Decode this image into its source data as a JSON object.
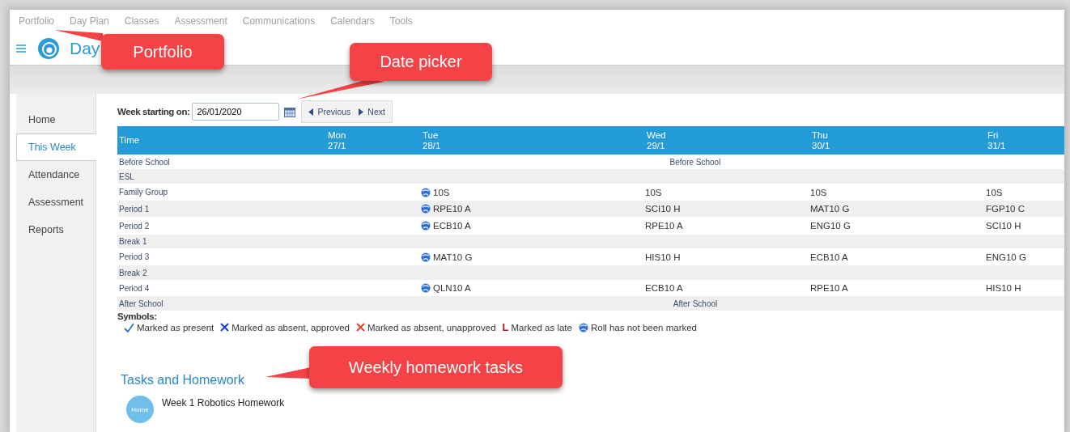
{
  "top_nav": [
    {
      "label": "Portfolio"
    },
    {
      "label": "Day Plan"
    },
    {
      "label": "Classes"
    },
    {
      "label": "Assessment"
    },
    {
      "label": "Communications"
    },
    {
      "label": "Calendars"
    },
    {
      "label": "Tools"
    }
  ],
  "logo": {
    "text": "Day"
  },
  "sidebar": {
    "items": [
      {
        "label": "Home",
        "selected": false
      },
      {
        "label": "This Week",
        "selected": true
      },
      {
        "label": "Attendance",
        "selected": false
      },
      {
        "label": "Assessment",
        "selected": false
      },
      {
        "label": "Reports",
        "selected": false
      }
    ]
  },
  "week_picker": {
    "label": "Week starting on:",
    "value": "26/01/2020",
    "previous": "Previous",
    "next": "Next"
  },
  "timetable": {
    "columns": [
      {
        "day": "Time"
      },
      {
        "day": "Mon",
        "date": "27/1"
      },
      {
        "day": "Tue",
        "date": "28/1"
      },
      {
        "day": "Wed",
        "date": "29/1"
      },
      {
        "day": "Thu",
        "date": "30/1"
      },
      {
        "day": "Fri",
        "date": "31/1"
      }
    ],
    "rows": [
      {
        "kind": "span",
        "label": "Before School",
        "span_text": "Before School"
      },
      {
        "kind": "break",
        "label": "ESL"
      },
      {
        "kind": "lesson",
        "label": "Family Group",
        "cells": [
          {
            "text": ""
          },
          {
            "text": "10S",
            "unmarked": true
          },
          {
            "text": "10S"
          },
          {
            "text": "10S"
          },
          {
            "text": "10S"
          }
        ]
      },
      {
        "kind": "lesson",
        "label": "Period 1",
        "cells": [
          {
            "text": ""
          },
          {
            "text": "RPE10 A",
            "unmarked": true
          },
          {
            "text": "SCI10 H"
          },
          {
            "text": "MAT10 G"
          },
          {
            "text": "FGP10 C"
          }
        ]
      },
      {
        "kind": "lesson",
        "label": "Period 2",
        "cells": [
          {
            "text": ""
          },
          {
            "text": "ECB10 A",
            "unmarked": true
          },
          {
            "text": "RPE10 A"
          },
          {
            "text": "ENG10 G"
          },
          {
            "text": "SCI10 H"
          }
        ]
      },
      {
        "kind": "break",
        "label": "Break 1"
      },
      {
        "kind": "lesson",
        "label": "Period 3",
        "cells": [
          {
            "text": ""
          },
          {
            "text": "MAT10 G",
            "unmarked": true
          },
          {
            "text": "HIS10 H"
          },
          {
            "text": "ECB10 A"
          },
          {
            "text": "ENG10 G"
          }
        ]
      },
      {
        "kind": "break",
        "label": "Break 2"
      },
      {
        "kind": "lesson",
        "label": "Period 4",
        "cells": [
          {
            "text": ""
          },
          {
            "text": "QLN10 A",
            "unmarked": true
          },
          {
            "text": "ECB10 A"
          },
          {
            "text": "RPE10 A"
          },
          {
            "text": "HIS10 H"
          }
        ]
      },
      {
        "kind": "span",
        "label": "After School",
        "span_text": "After School"
      }
    ]
  },
  "symbols": {
    "title": "Symbols:",
    "items": [
      {
        "kind": "present",
        "label": "Marked as present"
      },
      {
        "kind": "absent_approved",
        "label": "Marked as absent, approved"
      },
      {
        "kind": "absent_unapproved",
        "label": "Marked as absent, unapproved"
      },
      {
        "kind": "late",
        "label": "Marked as late",
        "glyph": "L"
      },
      {
        "kind": "unmarked",
        "label": "Roll has not been marked"
      }
    ]
  },
  "tasks": {
    "title": "Tasks and Homework",
    "items": [
      {
        "badge": "Home",
        "title": "Week 1 Robotics Homework"
      }
    ]
  },
  "callouts": [
    {
      "text": "Portfolio"
    },
    {
      "text": "Date picker"
    },
    {
      "text": "Weekly homework tasks"
    }
  ]
}
